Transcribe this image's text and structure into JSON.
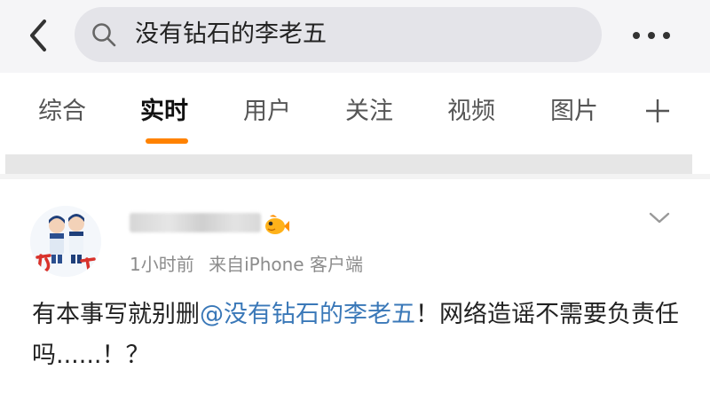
{
  "search": {
    "query": "没有钻石的李老五"
  },
  "tabs": [
    {
      "label": "综合",
      "active": false
    },
    {
      "label": "实时",
      "active": true
    },
    {
      "label": "用户",
      "active": false
    },
    {
      "label": "关注",
      "active": false
    },
    {
      "label": "视频",
      "active": false
    },
    {
      "label": "图片",
      "active": false
    }
  ],
  "post": {
    "time": "1小时前",
    "source": "来自iPhone 客户端",
    "text_before": "有本事写就别删",
    "mention": "@没有钻石的李老五",
    "text_after": "！网络造谣不需要负责任吗......！？"
  },
  "colors": {
    "accent": "#ff8200",
    "link": "#3a78b8",
    "topbar_bg": "#f5f5f7",
    "search_bg": "#e4e4e9"
  },
  "icons": [
    "back-arrow-icon",
    "search-icon",
    "more-icon",
    "plus-icon",
    "fish-badge-icon",
    "chevron-down-icon"
  ]
}
